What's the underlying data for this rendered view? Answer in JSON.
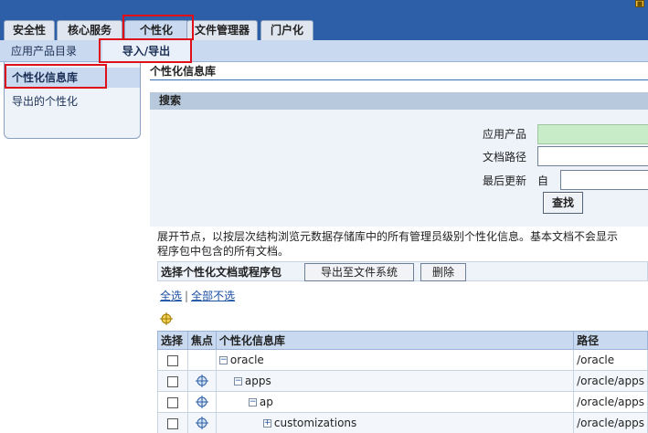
{
  "tabs": [
    {
      "label": "安全性"
    },
    {
      "label": "核心服务"
    },
    {
      "label": "个性化"
    },
    {
      "label": "文件管理器"
    },
    {
      "label": "门户化"
    }
  ],
  "subnav": {
    "catalog": "应用产品目录",
    "import_export": "导入/导出"
  },
  "sidebar": {
    "items": [
      {
        "label": "个性化信息库"
      },
      {
        "label": "导出的个性化"
      }
    ]
  },
  "main": {
    "title": "个性化信息库",
    "search": {
      "header": "搜索",
      "labels": {
        "product": "应用产品",
        "path": "文档路径",
        "updated": "最后更新",
        "since": "自"
      },
      "values": {
        "product": "",
        "path": "",
        "date": ""
      },
      "button": "查找"
    },
    "description_line1": "展开节点，以按层次结构浏览元数据存储库中的所有管理员级别个性化信息。基本文档不会显示",
    "description_line2": "程序包中包含的所有文档。",
    "actions": {
      "label": "选择个性化文档或程序包",
      "export": "导出至文件系统",
      "delete": "删除"
    },
    "select_all": "全选",
    "select_none": "全部不选",
    "table": {
      "headers": {
        "select": "选择",
        "focus": "焦点",
        "repo": "个性化信息库",
        "path": "路径"
      },
      "rows": [
        {
          "name": "oracle",
          "path": "/oracle",
          "expander": "−",
          "depth": 0,
          "focus": false
        },
        {
          "name": "apps",
          "path": "/oracle/apps",
          "expander": "−",
          "depth": 1,
          "focus": true
        },
        {
          "name": "ap",
          "path": "/oracle/apps",
          "expander": "−",
          "depth": 2,
          "focus": true
        },
        {
          "name": "customizations",
          "path": "/oracle/apps",
          "expander": "+",
          "depth": 3,
          "focus": true
        }
      ]
    }
  }
}
